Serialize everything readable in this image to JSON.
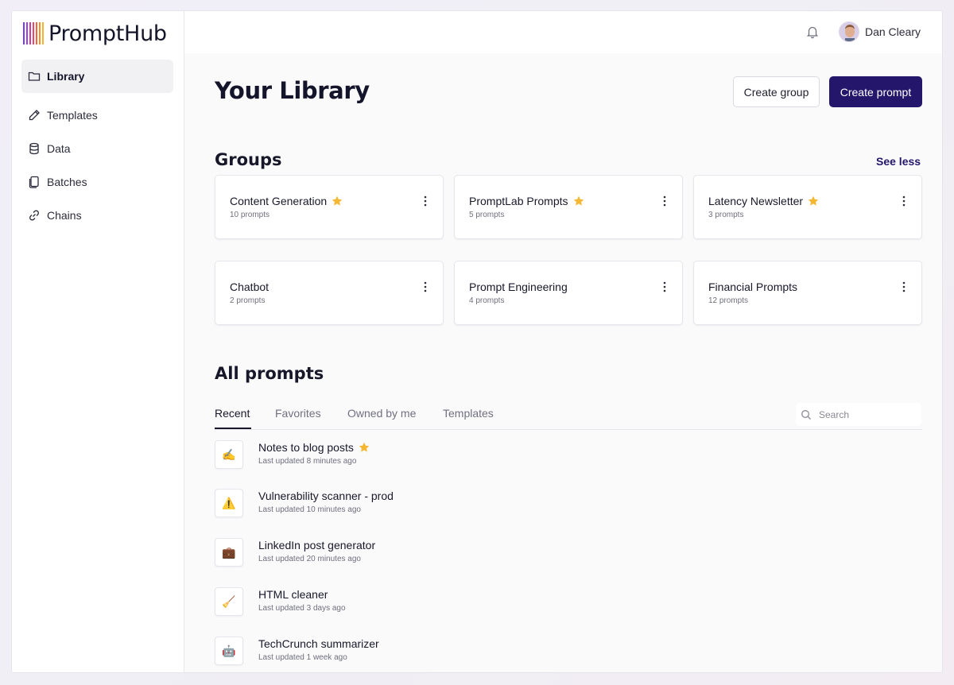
{
  "brand": {
    "name": "PromptHub"
  },
  "sidebar": {
    "items": [
      {
        "label": "Library",
        "icon": "folder-icon",
        "active": true
      },
      {
        "label": "Templates",
        "icon": "pencil-icon"
      },
      {
        "label": "Data",
        "icon": "database-icon"
      },
      {
        "label": "Batches",
        "icon": "batches-icon"
      },
      {
        "label": "Chains",
        "icon": "link-icon"
      }
    ]
  },
  "header": {
    "user_name": "Dan Cleary",
    "bell_icon": "bell-icon"
  },
  "page": {
    "title": "Your Library",
    "create_group_label": "Create group",
    "create_prompt_label": "Create prompt"
  },
  "groups": {
    "title": "Groups",
    "see_less_label": "See less",
    "items": [
      {
        "name": "Content Generation",
        "count": "10 prompts",
        "starred": true
      },
      {
        "name": "PromptLab Prompts",
        "count": "5 prompts",
        "starred": true
      },
      {
        "name": "Latency Newsletter",
        "count": "3 prompts",
        "starred": true
      },
      {
        "name": "Chatbot",
        "count": "2 prompts",
        "starred": false
      },
      {
        "name": "Prompt Engineering",
        "count": "4 prompts",
        "starred": false
      },
      {
        "name": "Financial Prompts",
        "count": "12 prompts",
        "starred": false
      }
    ]
  },
  "prompts": {
    "title": "All prompts",
    "tabs": [
      {
        "label": "Recent",
        "active": true
      },
      {
        "label": "Favorites"
      },
      {
        "label": "Owned by me"
      },
      {
        "label": "Templates"
      }
    ],
    "search_placeholder": "Search",
    "items": [
      {
        "emoji": "✍️",
        "name": "Notes to blog posts",
        "updated": "Last updated 8 minutes ago",
        "starred": true
      },
      {
        "emoji": "⚠️",
        "name": "Vulnerability scanner - prod",
        "updated": "Last updated 10 minutes ago",
        "starred": false
      },
      {
        "emoji": "💼",
        "name": "LinkedIn post generator",
        "updated": "Last updated 20 minutes ago",
        "starred": false
      },
      {
        "emoji": "🧹",
        "name": "HTML cleaner",
        "updated": "Last updated 3 days ago",
        "starred": false
      },
      {
        "emoji": "🤖",
        "name": "TechCrunch summarizer",
        "updated": "Last updated 1 week ago",
        "starred": false
      }
    ]
  },
  "colors": {
    "primary": "#24176b",
    "star": "#f5b731"
  }
}
